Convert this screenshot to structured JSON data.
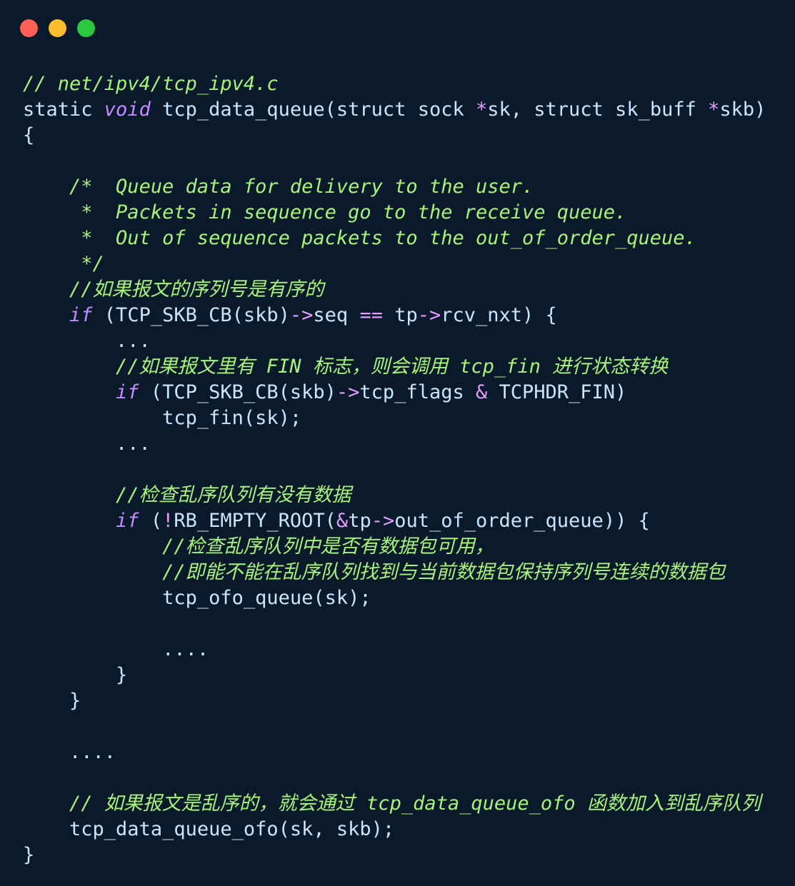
{
  "window": {
    "buttons": [
      {
        "name": "close",
        "color": "#ff5f57"
      },
      {
        "name": "minimize",
        "color": "#febc2e"
      },
      {
        "name": "maximize",
        "color": "#28c840"
      }
    ]
  },
  "code": {
    "lines": [
      {
        "indent": "",
        "tokens": [
          {
            "t": "// net/ipv4/tcp_ipv4.c",
            "c": "comment"
          }
        ]
      },
      {
        "indent": "",
        "tokens": [
          {
            "t": "static ",
            "c": "kw-plain"
          },
          {
            "t": "void",
            "c": "kw"
          },
          {
            "t": " tcp_data_queue(struct sock ",
            "c": "ident"
          },
          {
            "t": "*",
            "c": "op"
          },
          {
            "t": "sk, struct sk_buff ",
            "c": "ident"
          },
          {
            "t": "*",
            "c": "op"
          },
          {
            "t": "skb)",
            "c": "ident"
          }
        ]
      },
      {
        "indent": "",
        "tokens": [
          {
            "t": "{",
            "c": "punc"
          }
        ]
      },
      {
        "indent": "",
        "tokens": []
      },
      {
        "indent": "    ",
        "tokens": [
          {
            "t": "/*  Queue data for delivery to the user.",
            "c": "comment"
          }
        ]
      },
      {
        "indent": "    ",
        "tokens": [
          {
            "t": " *  Packets in sequence go to the receive queue.",
            "c": "comment"
          }
        ]
      },
      {
        "indent": "    ",
        "tokens": [
          {
            "t": " *  Out of sequence packets to the out_of_order_queue.",
            "c": "comment"
          }
        ]
      },
      {
        "indent": "    ",
        "tokens": [
          {
            "t": " */",
            "c": "comment"
          }
        ]
      },
      {
        "indent": "    ",
        "tokens": [
          {
            "t": "//如果报文的序列号是有序的",
            "c": "comment"
          }
        ]
      },
      {
        "indent": "    ",
        "tokens": [
          {
            "t": "if",
            "c": "kw"
          },
          {
            "t": " (TCP_SKB_CB(skb)",
            "c": "ident"
          },
          {
            "t": "->",
            "c": "op"
          },
          {
            "t": "seq ",
            "c": "ident"
          },
          {
            "t": "==",
            "c": "op"
          },
          {
            "t": " tp",
            "c": "ident"
          },
          {
            "t": "->",
            "c": "op"
          },
          {
            "t": "rcv_nxt) {",
            "c": "ident"
          }
        ]
      },
      {
        "indent": "        ",
        "tokens": [
          {
            "t": "...",
            "c": "punc"
          }
        ]
      },
      {
        "indent": "        ",
        "tokens": [
          {
            "t": "//如果报文里有 FIN 标志，则会调用 tcp_fin 进行状态转换",
            "c": "comment"
          }
        ]
      },
      {
        "indent": "        ",
        "tokens": [
          {
            "t": "if",
            "c": "kw"
          },
          {
            "t": " (TCP_SKB_CB(skb)",
            "c": "ident"
          },
          {
            "t": "->",
            "c": "op"
          },
          {
            "t": "tcp_flags ",
            "c": "ident"
          },
          {
            "t": "&",
            "c": "op"
          },
          {
            "t": " TCPHDR_FIN)",
            "c": "ident"
          }
        ]
      },
      {
        "indent": "            ",
        "tokens": [
          {
            "t": "tcp_fin(sk);",
            "c": "ident"
          }
        ]
      },
      {
        "indent": "        ",
        "tokens": [
          {
            "t": "...",
            "c": "punc"
          }
        ]
      },
      {
        "indent": "",
        "tokens": []
      },
      {
        "indent": "        ",
        "tokens": [
          {
            "t": "//检查乱序队列有没有数据",
            "c": "comment"
          }
        ]
      },
      {
        "indent": "        ",
        "tokens": [
          {
            "t": "if",
            "c": "kw"
          },
          {
            "t": " (",
            "c": "ident"
          },
          {
            "t": "!",
            "c": "op"
          },
          {
            "t": "RB_EMPTY_ROOT(",
            "c": "ident"
          },
          {
            "t": "&",
            "c": "op"
          },
          {
            "t": "tp",
            "c": "ident"
          },
          {
            "t": "->",
            "c": "op"
          },
          {
            "t": "out_of_order_queue)) {",
            "c": "ident"
          }
        ]
      },
      {
        "indent": "            ",
        "tokens": [
          {
            "t": "//检查乱序队列中是否有数据包可用，",
            "c": "comment"
          }
        ]
      },
      {
        "indent": "            ",
        "tokens": [
          {
            "t": "//即能不能在乱序队列找到与当前数据包保持序列号连续的数据包",
            "c": "comment"
          }
        ]
      },
      {
        "indent": "            ",
        "tokens": [
          {
            "t": "tcp_ofo_queue(sk);",
            "c": "ident"
          }
        ]
      },
      {
        "indent": "",
        "tokens": []
      },
      {
        "indent": "            ",
        "tokens": [
          {
            "t": "....",
            "c": "punc"
          }
        ]
      },
      {
        "indent": "        ",
        "tokens": [
          {
            "t": "}",
            "c": "punc"
          }
        ]
      },
      {
        "indent": "    ",
        "tokens": [
          {
            "t": "}",
            "c": "punc"
          }
        ]
      },
      {
        "indent": "",
        "tokens": []
      },
      {
        "indent": "    ",
        "tokens": [
          {
            "t": "....",
            "c": "punc"
          }
        ]
      },
      {
        "indent": "",
        "tokens": []
      },
      {
        "indent": "    ",
        "tokens": [
          {
            "t": "// 如果报文是乱序的，就会通过 tcp_data_queue_ofo 函数加入到乱序队列",
            "c": "comment"
          }
        ]
      },
      {
        "indent": "    ",
        "tokens": [
          {
            "t": "tcp_data_queue_ofo(sk, skb);",
            "c": "ident"
          }
        ]
      },
      {
        "indent": "",
        "tokens": [
          {
            "t": "}",
            "c": "punc"
          }
        ]
      }
    ]
  }
}
